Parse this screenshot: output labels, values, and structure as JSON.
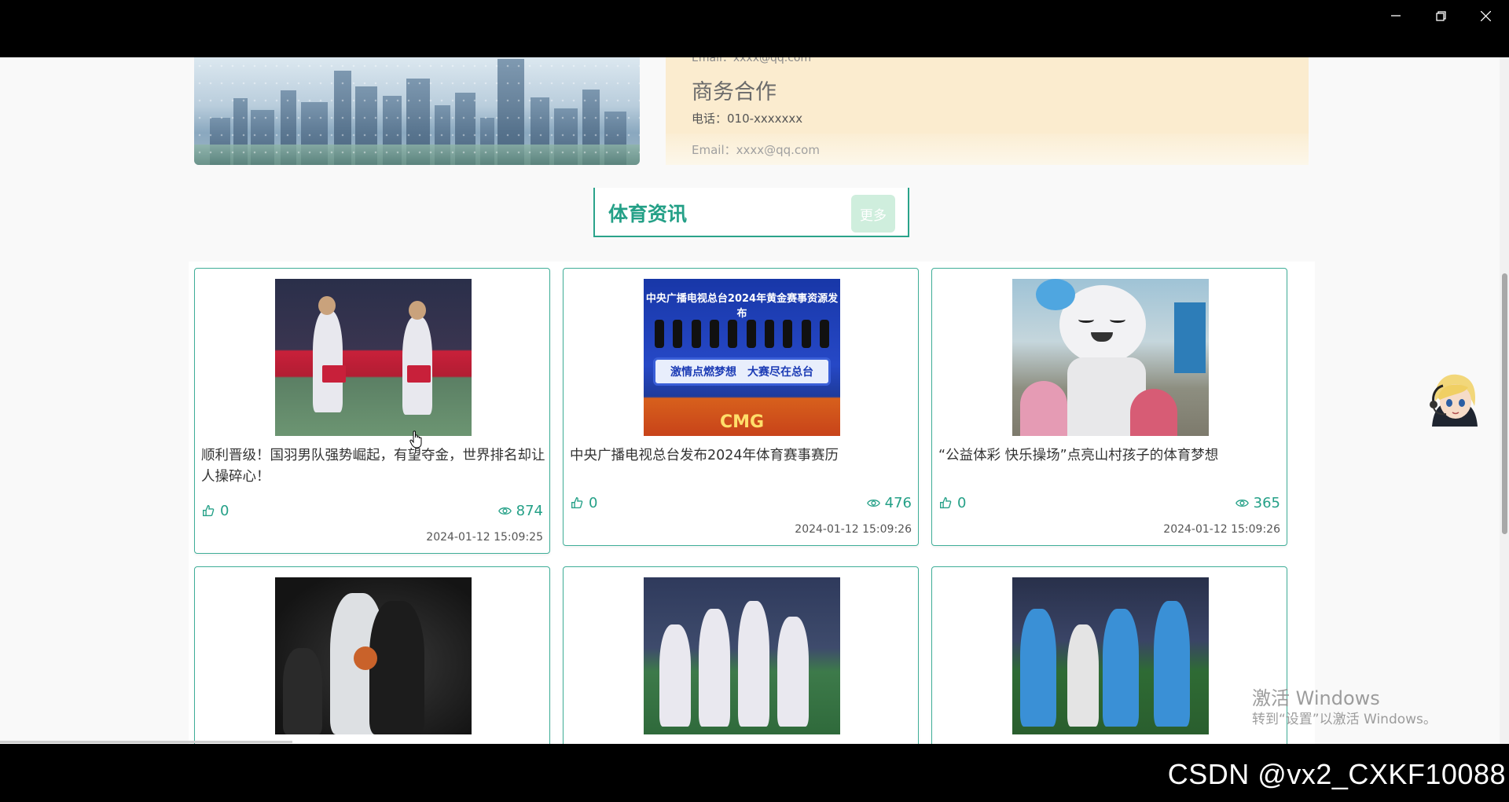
{
  "window": {
    "minimize_icon": "minimize-icon",
    "restore_icon": "restore-icon",
    "close_icon": "close-icon"
  },
  "contact": {
    "cut_line": "Email：xxxx@qq.com",
    "title": "商务合作",
    "phone": "电话：010-xxxxxxx",
    "email": "Email：xxxx@qq.com"
  },
  "section": {
    "title": "体育资讯",
    "more_label": "更多"
  },
  "cards": [
    {
      "title": "顺利晋级！国羽男队强势崛起，有望夺金，世界排名却让人操碎心！",
      "likes": "0",
      "views": "874",
      "date": "2024-01-12 15:09:25",
      "thumb": "badminton-photo"
    },
    {
      "title": "中央广播电视总台发布2024年体育赛事赛历",
      "likes": "0",
      "views": "476",
      "date": "2024-01-12 15:09:26",
      "thumb": "cmg-event-photo"
    },
    {
      "title": "“公益体彩 快乐操场”点亮山村孩子的体育梦想",
      "likes": "0",
      "views": "365",
      "date": "2024-01-12 15:09:26",
      "thumb": "mascot-photo"
    },
    {
      "thumb": "basketball-photo"
    },
    {
      "thumb": "womens-soccer-photo"
    },
    {
      "thumb": "soccer-photo"
    }
  ],
  "cmg_banner": {
    "top": "中央广播电视总台2024年黄金赛事资源发布",
    "middle": "激情点燃梦想　大赛尽在总台",
    "logo": "CMG"
  },
  "watermark": {
    "line1": "激活 Windows",
    "line2": "转到“设置”以激活 Windows。"
  },
  "footer": {
    "csdn": "CSDN @vx2_CXKF10088"
  },
  "colors": {
    "accent": "#24a087",
    "border": "#3fae98",
    "contact_bg": "#fbeccf"
  }
}
